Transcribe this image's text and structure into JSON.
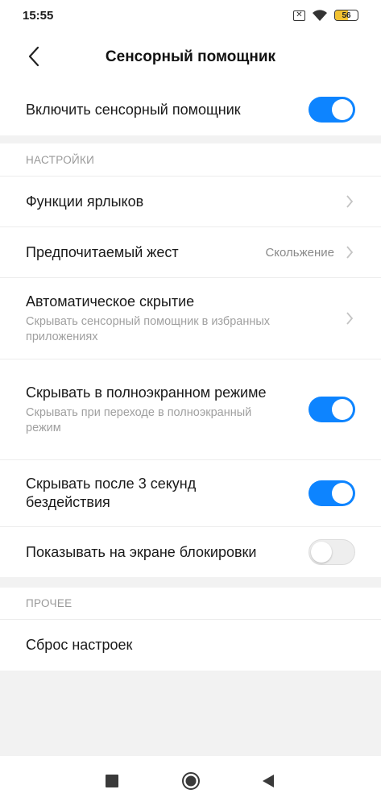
{
  "status_bar": {
    "time": "15:55",
    "sim_icon": "sim-off-icon",
    "wifi_icon": "wifi-icon",
    "battery_level": "56"
  },
  "header": {
    "title": "Сенсорный помощник",
    "back_icon": "back-icon"
  },
  "main_toggle": {
    "label": "Включить сенсорный помощник",
    "enabled": true
  },
  "settings": {
    "section_label": "НАСТРОЙКИ",
    "shortcuts": {
      "title": "Функции ярлыков"
    },
    "gesture": {
      "title": "Предпочитаемый жест",
      "value": "Скольжение"
    },
    "auto_hide": {
      "title": "Автоматическое скрытие",
      "subtitle": "Скрывать сенсорный помощник в избранных приложениях"
    },
    "hide_fullscreen": {
      "title": "Скрывать в полноэкранном режиме",
      "subtitle": "Скрывать при переходе в полноэкранный режим",
      "enabled": true
    },
    "hide_idle": {
      "title": "Скрывать после 3 секунд бездействия",
      "enabled": true
    },
    "lock_screen": {
      "title": "Показывать на экране блокировки",
      "enabled": false
    }
  },
  "other": {
    "section_label": "ПРОЧЕЕ",
    "reset": {
      "title": "Сброс настроек"
    }
  },
  "nav": {
    "recents_icon": "square-icon",
    "home_icon": "home-circle-icon",
    "back_icon": "triangle-back-icon"
  },
  "colors": {
    "accent": "#0d84ff",
    "background": "#f2f2f2",
    "battery": "#f2c232"
  }
}
